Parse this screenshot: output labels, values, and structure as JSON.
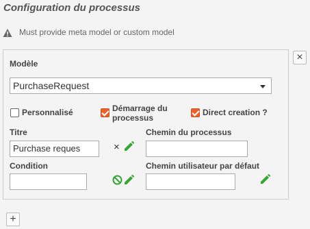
{
  "page": {
    "title": "Configuration du processus"
  },
  "warning": {
    "text": "Must provide meta model or custom model",
    "icon": "warning-icon"
  },
  "panel": {
    "close_label": "×",
    "model": {
      "label": "Modèle",
      "value": "PurchaseRequest"
    },
    "checkboxes": [
      {
        "label": "Personnalisé",
        "checked": false
      },
      {
        "label_line1": "Démarrage du",
        "label_line2": "processus",
        "checked": true
      },
      {
        "label": "Direct creation ?",
        "checked": true
      }
    ],
    "title_field": {
      "label": "Titre",
      "value": "Purchase reques",
      "clear_label": "×"
    },
    "process_path": {
      "label": "Chemin du processus",
      "value": ""
    },
    "condition": {
      "label": "Condition",
      "value": ""
    },
    "user_path": {
      "label": "Chemin utilisateur par défaut",
      "value": ""
    }
  },
  "add_label": "+",
  "colors": {
    "accent": "#e8622c",
    "edit_green": "#3aa33a"
  }
}
